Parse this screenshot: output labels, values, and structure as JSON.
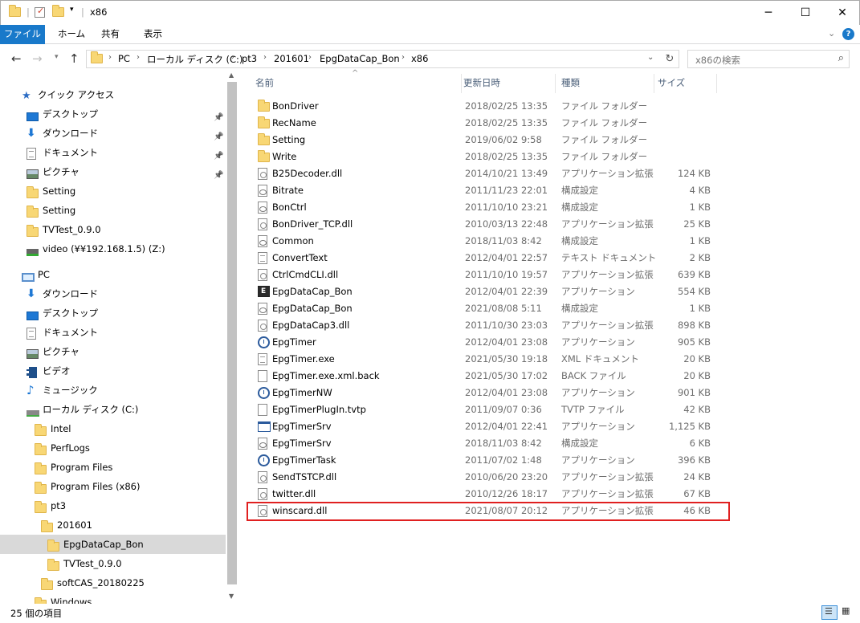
{
  "window": {
    "title": "x86",
    "controls": {
      "minimize": "─",
      "maximize": "☐",
      "close": "✕"
    }
  },
  "ribbon": {
    "tabs": [
      "ファイル",
      "ホーム",
      "共有",
      "表示"
    ],
    "expand_icon": "chevron-down-icon",
    "help_icon": "help-icon"
  },
  "address": {
    "crumbs": [
      "PC",
      "ローカル ディスク (C:)",
      "pt3",
      "201601",
      "EpgDataCap_Bon",
      "x86"
    ],
    "search_placeholder": "x86の検索"
  },
  "nav_pane": {
    "items": [
      {
        "label": "クイック アクセス",
        "icon": "star-icon",
        "indent": 1,
        "pinned": false,
        "selected": false
      },
      {
        "label": "デスクトップ",
        "icon": "desktop-icon",
        "indent": 2,
        "pinned": true,
        "selected": false
      },
      {
        "label": "ダウンロード",
        "icon": "download-icon",
        "indent": 2,
        "pinned": true,
        "selected": false
      },
      {
        "label": "ドキュメント",
        "icon": "document-icon",
        "indent": 2,
        "pinned": true,
        "selected": false
      },
      {
        "label": "ピクチャ",
        "icon": "pictures-icon",
        "indent": 2,
        "pinned": true,
        "selected": false
      },
      {
        "label": "Setting",
        "icon": "folder-icon",
        "indent": 2,
        "pinned": false,
        "selected": false
      },
      {
        "label": "Setting",
        "icon": "folder-icon",
        "indent": 2,
        "pinned": false,
        "selected": false
      },
      {
        "label": "TVTest_0.9.0",
        "icon": "folder-icon",
        "indent": 2,
        "pinned": false,
        "selected": false
      },
      {
        "label": "video (¥¥192.168.1.5) (Z:)",
        "icon": "network-drive-icon",
        "indent": 2,
        "pinned": false,
        "selected": false
      },
      {
        "label": "PC",
        "icon": "pc-icon",
        "indent": 1,
        "pinned": false,
        "selected": false
      },
      {
        "label": "ダウンロード",
        "icon": "download-icon",
        "indent": 2,
        "pinned": false,
        "selected": false
      },
      {
        "label": "デスクトップ",
        "icon": "desktop-icon",
        "indent": 2,
        "pinned": false,
        "selected": false
      },
      {
        "label": "ドキュメント",
        "icon": "document-icon",
        "indent": 2,
        "pinned": false,
        "selected": false
      },
      {
        "label": "ピクチャ",
        "icon": "pictures-icon",
        "indent": 2,
        "pinned": false,
        "selected": false
      },
      {
        "label": "ビデオ",
        "icon": "video-icon",
        "indent": 2,
        "pinned": false,
        "selected": false
      },
      {
        "label": "ミュージック",
        "icon": "music-icon",
        "indent": 2,
        "pinned": false,
        "selected": false
      },
      {
        "label": "ローカル ディスク (C:)",
        "icon": "disk-icon",
        "indent": 2,
        "pinned": false,
        "selected": false
      },
      {
        "label": "Intel",
        "icon": "folder-icon",
        "indent": 3,
        "pinned": false,
        "selected": false
      },
      {
        "label": "PerfLogs",
        "icon": "folder-icon",
        "indent": 3,
        "pinned": false,
        "selected": false
      },
      {
        "label": "Program Files",
        "icon": "folder-icon",
        "indent": 3,
        "pinned": false,
        "selected": false
      },
      {
        "label": "Program Files (x86)",
        "icon": "folder-icon",
        "indent": 3,
        "pinned": false,
        "selected": false
      },
      {
        "label": "pt3",
        "icon": "folder-icon",
        "indent": 3,
        "pinned": false,
        "selected": false
      },
      {
        "label": "201601",
        "icon": "folder-icon",
        "indent": 4,
        "pinned": false,
        "selected": false
      },
      {
        "label": "EpgDataCap_Bon",
        "icon": "folder-icon",
        "indent": 5,
        "pinned": false,
        "selected": true
      },
      {
        "label": "TVTest_0.9.0",
        "icon": "folder-icon",
        "indent": 5,
        "pinned": false,
        "selected": false
      },
      {
        "label": "softCAS_20180225",
        "icon": "folder-icon",
        "indent": 4,
        "pinned": false,
        "selected": false
      },
      {
        "label": "Windows",
        "icon": "folder-icon",
        "indent": 3,
        "pinned": false,
        "selected": false
      }
    ]
  },
  "columns": {
    "name": "名前",
    "date": "更新日時",
    "type": "種類",
    "size": "サイズ"
  },
  "files": [
    {
      "name": "BonDriver",
      "date": "2018/02/25 13:35",
      "type": "ファイル フォルダー",
      "size": "",
      "icon": "folder-icon"
    },
    {
      "name": "RecName",
      "date": "2018/02/25 13:35",
      "type": "ファイル フォルダー",
      "size": "",
      "icon": "folder-icon"
    },
    {
      "name": "Setting",
      "date": "2019/06/02 9:58",
      "type": "ファイル フォルダー",
      "size": "",
      "icon": "folder-icon"
    },
    {
      "name": "Write",
      "date": "2018/02/25 13:35",
      "type": "ファイル フォルダー",
      "size": "",
      "icon": "folder-icon"
    },
    {
      "name": "B25Decoder.dll",
      "date": "2014/10/21 13:49",
      "type": "アプリケーション拡張",
      "size": "124 KB",
      "icon": "dll-icon"
    },
    {
      "name": "Bitrate",
      "date": "2011/11/23 22:01",
      "type": "構成設定",
      "size": "4 KB",
      "icon": "config-icon"
    },
    {
      "name": "BonCtrl",
      "date": "2011/10/10 23:21",
      "type": "構成設定",
      "size": "1 KB",
      "icon": "config-icon"
    },
    {
      "name": "BonDriver_TCP.dll",
      "date": "2010/03/13 22:48",
      "type": "アプリケーション拡張",
      "size": "25 KB",
      "icon": "dll-icon"
    },
    {
      "name": "Common",
      "date": "2018/11/03 8:42",
      "type": "構成設定",
      "size": "1 KB",
      "icon": "config-icon"
    },
    {
      "name": "ConvertText",
      "date": "2012/04/01 22:57",
      "type": "テキスト ドキュメント",
      "size": "2 KB",
      "icon": "text-icon"
    },
    {
      "name": "CtrlCmdCLI.dll",
      "date": "2011/10/10 19:57",
      "type": "アプリケーション拡張",
      "size": "639 KB",
      "icon": "dll-icon"
    },
    {
      "name": "EpgDataCap_Bon",
      "date": "2012/04/01 22:39",
      "type": "アプリケーション",
      "size": "554 KB",
      "icon": "app-icon"
    },
    {
      "name": "EpgDataCap_Bon",
      "date": "2021/08/08 5:11",
      "type": "構成設定",
      "size": "1 KB",
      "icon": "config-icon"
    },
    {
      "name": "EpgDataCap3.dll",
      "date": "2011/10/30 23:03",
      "type": "アプリケーション拡張",
      "size": "898 KB",
      "icon": "dll-icon"
    },
    {
      "name": "EpgTimer",
      "date": "2012/04/01 23:08",
      "type": "アプリケーション",
      "size": "905 KB",
      "icon": "clock-icon"
    },
    {
      "name": "EpgTimer.exe",
      "date": "2021/05/30 19:18",
      "type": "XML ドキュメント",
      "size": "20 KB",
      "icon": "text-icon"
    },
    {
      "name": "EpgTimer.exe.xml.back",
      "date": "2021/05/30 17:02",
      "type": "BACK ファイル",
      "size": "20 KB",
      "icon": "blank-file-icon"
    },
    {
      "name": "EpgTimerNW",
      "date": "2012/04/01 23:08",
      "type": "アプリケーション",
      "size": "901 KB",
      "icon": "clock-icon"
    },
    {
      "name": "EpgTimerPlugIn.tvtp",
      "date": "2011/09/07 0:36",
      "type": "TVTP ファイル",
      "size": "42 KB",
      "icon": "blank-file-icon"
    },
    {
      "name": "EpgTimerSrv",
      "date": "2012/04/01 22:41",
      "type": "アプリケーション",
      "size": "1,125 KB",
      "icon": "window-app-icon"
    },
    {
      "name": "EpgTimerSrv",
      "date": "2018/11/03 8:42",
      "type": "構成設定",
      "size": "6 KB",
      "icon": "config-icon"
    },
    {
      "name": "EpgTimerTask",
      "date": "2011/07/02 1:48",
      "type": "アプリケーション",
      "size": "396 KB",
      "icon": "clock-icon"
    },
    {
      "name": "SendTSTCP.dll",
      "date": "2010/06/20 23:20",
      "type": "アプリケーション拡張",
      "size": "24 KB",
      "icon": "dll-icon"
    },
    {
      "name": "twitter.dll",
      "date": "2010/12/26 18:17",
      "type": "アプリケーション拡張",
      "size": "67 KB",
      "icon": "dll-icon"
    },
    {
      "name": "winscard.dll",
      "date": "2021/08/07 20:12",
      "type": "アプリケーション拡張",
      "size": "46 KB",
      "icon": "dll-icon",
      "highlighted": true
    }
  ],
  "status": {
    "item_count": "25 個の項目"
  },
  "colors": {
    "file_tab": "#1979ca",
    "highlight_border": "#e02020",
    "selected_nav": "#d9d9d9"
  }
}
